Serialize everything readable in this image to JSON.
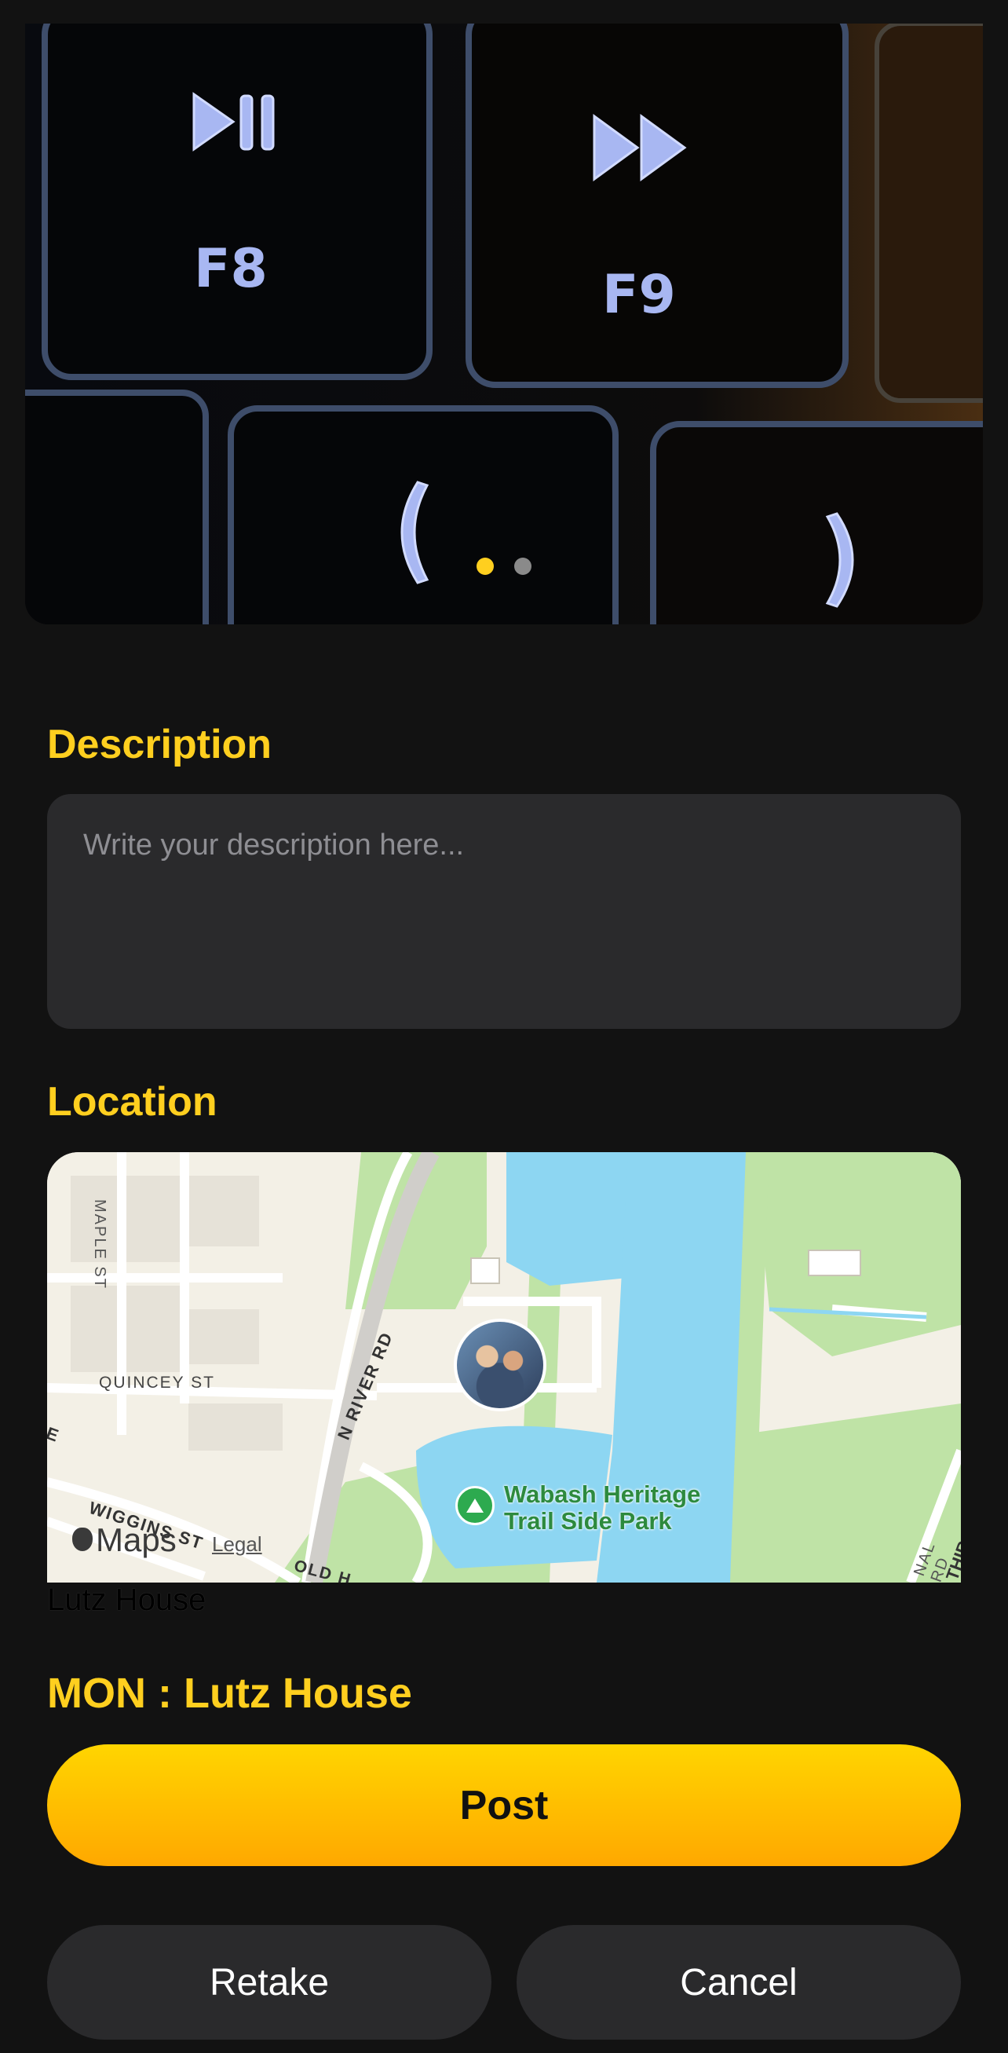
{
  "carousel": {
    "active_index": 0,
    "count": 2,
    "active_color": "#FFCF1F",
    "inactive_color": "#8A8A8A"
  },
  "description": {
    "label": "Description",
    "placeholder": "Write your description here...",
    "value": ""
  },
  "location": {
    "label": "Location",
    "map": {
      "brand": "Maps",
      "legal": "Legal",
      "streets": [
        "MAPLE ST",
        "QUINCEY ST",
        "N RIVER RD",
        "WIGGINS ST",
        "OLD H",
        "NAL RD",
        "THIR",
        "E"
      ],
      "poi": {
        "line1": "Wabash Heritage",
        "line2": "Trail Side Park",
        "icon": "park-tree-icon"
      },
      "marker_icon": "user-photo-marker"
    },
    "place_name": "Lutz House"
  },
  "schedule_label": "MON : Lutz House",
  "actions": {
    "post": "Post",
    "retake": "Retake",
    "cancel": "Cancel"
  },
  "colors": {
    "accent": "#FFCF1F",
    "background": "#121212",
    "surface": "#2A2A2C"
  }
}
